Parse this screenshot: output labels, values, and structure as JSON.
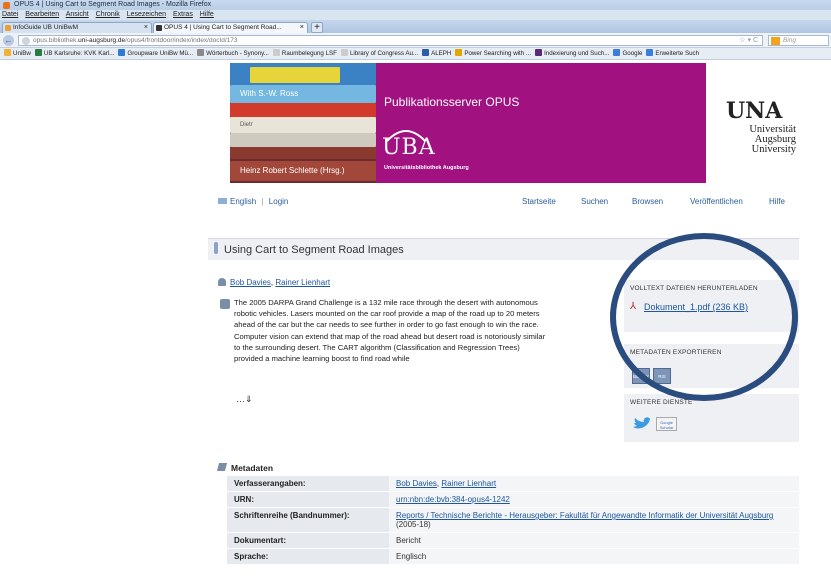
{
  "browser": {
    "window_title": "OPUS 4 | Using Cart to Segment Road Images - Mozilla Firefox",
    "menu": [
      "Datei",
      "Bearbeiten",
      "Ansicht",
      "Chronik",
      "Lesezeichen",
      "Extras",
      "Hilfe"
    ],
    "tabs": [
      {
        "label": "InfoGuide UB UniBwM"
      },
      {
        "label": "OPUS 4 | Using Cart to Segment Road..."
      }
    ],
    "new_tab": "+",
    "back": "←",
    "url_prefix": "opus.bibliothek.",
    "url_domain": "uni-augsburg.de",
    "url_path": "/opus4/frontdoor/index/index/docId/173",
    "url_icons": "☆ ▾ C",
    "search_placeholder": "Bing",
    "bookmarks": [
      {
        "label": "UniBw",
        "color": "#f2b134"
      },
      {
        "label": "UB Karlsruhe: KVK Karl...",
        "color": "#2b7a3f"
      },
      {
        "label": "Groupware UniBw Mü...",
        "color": "#2f7bd2"
      },
      {
        "label": "Wörterbuch - Synony...",
        "color": "#8a8a8a"
      },
      {
        "label": "Raumbelegung LSF",
        "color": "#cccccc"
      },
      {
        "label": "Library of Congress Au...",
        "color": "#cccccc"
      },
      {
        "label": "ALEPH",
        "color": "#2b5aa8"
      },
      {
        "label": "Power Searching with ...",
        "color": "#e2a600"
      },
      {
        "label": "Indexierung und Such...",
        "color": "#5a2a7a"
      },
      {
        "label": "Google",
        "color": "#3b7ddd"
      },
      {
        "label": "Erweiterte Such",
        "color": "#3b7ddd"
      }
    ]
  },
  "banner": {
    "title": "Publikationsserver OPUS",
    "uba": "UBA",
    "uba_sub": "Universitätsbibliothek Augsburg",
    "uni_abbr": "UNA",
    "uni_name_1": "Universität",
    "uni_name_2": "Augsburg",
    "uni_name_3": "University",
    "book_spine_1": "With S.-W. Ross",
    "book_spine_2": "Dietr",
    "book_spine_3": "Heinz Robert Schlette (Hrsg.)"
  },
  "toplinks": {
    "english": "English",
    "sep": "|",
    "login": "Login"
  },
  "nav": [
    "Startseite",
    "Suchen",
    "Browsen",
    "Veröffentlichen",
    "Hilfe"
  ],
  "document": {
    "title": "Using Cart to Segment Road Images",
    "author_1": "Bob Davies",
    "author_2": "Rainer Lienhart",
    "author_sep": ",",
    "abstract": "The 2005 DARPA Grand Challenge is a 132 mile race through the desert with autonomous robotic vehicles. Lasers mounted on the car roof provide a map of the road up to 20 meters ahead of the car but the car needs to see further in order to go fast enough to win the race. Computer vision can extend that map of the road ahead but desert road is notoriously similar to the surrounding desert. The CART algorithm (Classification and Regression Trees) provided a machine learning boost to find road while",
    "more": "…⇓"
  },
  "sidebar": {
    "download_head": "VOLLTEXT DATEIEN HERUNTERLADEN",
    "download_link": "Dokument_1.pdf (236 KB)",
    "export_head": "METADATEN EXPORTIEREN",
    "export_icons": [
      "BIBTEX",
      "RIS"
    ],
    "services_head": "WEITERE DIENSTE",
    "google_scholar": "Google Scholar"
  },
  "metadata": {
    "heading": "Metadaten",
    "rows": [
      {
        "key": "Verfasserangaben:",
        "links": [
          "Bob Davies",
          "Rainer Lienhart"
        ],
        "sep": ", "
      },
      {
        "key": "URN:",
        "links": [
          "urn:nbn:de:bvb:384-opus4-1242"
        ]
      },
      {
        "key": "Schriftenreihe (Bandnummer):",
        "links": [
          "Reports / Technische Berichte - Herausgeber: Fakultät für Angewandte Informatik der Universität Augsburg"
        ],
        "suffix": " (2005-18)"
      },
      {
        "key": "Dokumentart:",
        "value": "Bericht"
      },
      {
        "key": "Sprache:",
        "value": "Englisch"
      }
    ]
  },
  "colors": {
    "magenta": "#a1117f",
    "link": "#1e56a0",
    "annotation_circle": "#2b4c7e"
  }
}
